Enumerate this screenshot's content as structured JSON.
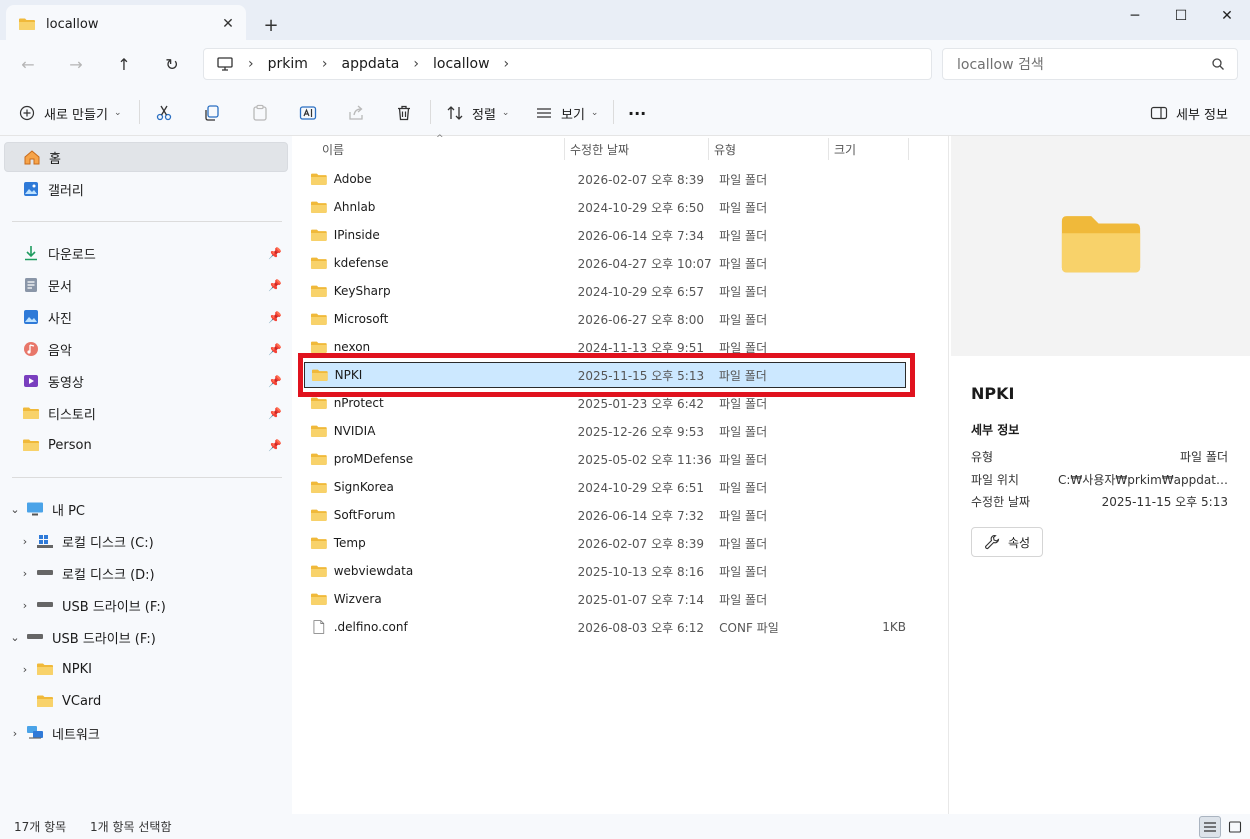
{
  "tab": {
    "title": "locallow",
    "new_tab": "+"
  },
  "address": {
    "crumbs": [
      "prkim",
      "appdata",
      "locallow"
    ]
  },
  "search": {
    "placeholder": "locallow 검색"
  },
  "commands": {
    "new": "새로 만들기",
    "sort": "정렬",
    "view": "보기",
    "more": "···",
    "details": "세부 정보"
  },
  "sidebar": {
    "quick": [
      {
        "label": "홈",
        "icon": "home-icon"
      },
      {
        "label": "갤러리",
        "icon": "gallery-icon"
      }
    ],
    "pinned": [
      {
        "label": "다운로드",
        "icon": "download-icon"
      },
      {
        "label": "문서",
        "icon": "document-icon"
      },
      {
        "label": "사진",
        "icon": "picture-icon"
      },
      {
        "label": "음악",
        "icon": "music-icon"
      },
      {
        "label": "동영상",
        "icon": "video-icon"
      },
      {
        "label": "티스토리",
        "icon": "folder-icon"
      },
      {
        "label": "Person",
        "icon": "folder-icon"
      }
    ],
    "tree": [
      {
        "label": "내 PC",
        "icon": "pc-icon"
      },
      {
        "label": "로컬 디스크 (C:)",
        "icon": "drive-c-icon"
      },
      {
        "label": "로컬 디스크 (D:)",
        "icon": "drive-icon"
      },
      {
        "label": "USB 드라이브 (F:)",
        "icon": "drive-icon"
      },
      {
        "label": "USB 드라이브 (F:)",
        "icon": "drive-icon"
      },
      {
        "label": "NPKI",
        "icon": "folder-icon"
      },
      {
        "label": "VCard",
        "icon": "folder-icon"
      },
      {
        "label": "네트워크",
        "icon": "network-icon"
      }
    ]
  },
  "columns": {
    "name": "이름",
    "date": "수정한 날짜",
    "type": "유형",
    "size": "크기"
  },
  "files": [
    {
      "name": "Adobe",
      "date": "2026-02-07 오후 8:39",
      "type": "파일 폴더",
      "size": ""
    },
    {
      "name": "Ahnlab",
      "date": "2024-10-29 오후 6:50",
      "type": "파일 폴더",
      "size": ""
    },
    {
      "name": "IPinside",
      "date": "2026-06-14 오후 7:34",
      "type": "파일 폴더",
      "size": ""
    },
    {
      "name": "kdefense",
      "date": "2026-04-27 오후 10:07",
      "type": "파일 폴더",
      "size": ""
    },
    {
      "name": "KeySharp",
      "date": "2024-10-29 오후 6:57",
      "type": "파일 폴더",
      "size": ""
    },
    {
      "name": "Microsoft",
      "date": "2026-06-27 오후 8:00",
      "type": "파일 폴더",
      "size": ""
    },
    {
      "name": "nexon",
      "date": "2024-11-13 오후 9:51",
      "type": "파일 폴더",
      "size": ""
    },
    {
      "name": "NPKI",
      "date": "2025-11-15 오후 5:13",
      "type": "파일 폴더",
      "size": ""
    },
    {
      "name": "nProtect",
      "date": "2025-01-23 오후 6:42",
      "type": "파일 폴더",
      "size": ""
    },
    {
      "name": "NVIDIA",
      "date": "2025-12-26 오후 9:53",
      "type": "파일 폴더",
      "size": ""
    },
    {
      "name": "proMDefense",
      "date": "2025-05-02 오후 11:36",
      "type": "파일 폴더",
      "size": ""
    },
    {
      "name": "SignKorea",
      "date": "2024-10-29 오후 6:51",
      "type": "파일 폴더",
      "size": ""
    },
    {
      "name": "SoftForum",
      "date": "2026-06-14 오후 7:32",
      "type": "파일 폴더",
      "size": ""
    },
    {
      "name": "Temp",
      "date": "2026-02-07 오후 8:39",
      "type": "파일 폴더",
      "size": ""
    },
    {
      "name": "webviewdata",
      "date": "2025-10-13 오후 8:16",
      "type": "파일 폴더",
      "size": ""
    },
    {
      "name": "Wizvera",
      "date": "2025-01-07 오후 7:14",
      "type": "파일 폴더",
      "size": ""
    },
    {
      "name": ".delfino.conf",
      "date": "2026-08-03 오후 6:12",
      "type": "CONF 파일",
      "size": "1KB"
    }
  ],
  "details": {
    "title": "NPKI",
    "section": "세부 정보",
    "rows": [
      {
        "key": "유형",
        "value": "파일 폴더"
      },
      {
        "key": "파일 위치",
        "value": "C:₩사용자₩prkim₩appdata..."
      },
      {
        "key": "수정한 날짜",
        "value": "2025-11-15 오후 5:13"
      }
    ],
    "properties": "속성"
  },
  "status": {
    "count": "17개 항목",
    "selected": "1개 항목 선택함"
  },
  "colors": {
    "folder": "#f4c64d",
    "selection": "#cce8ff",
    "highlight": "#e0121e"
  }
}
